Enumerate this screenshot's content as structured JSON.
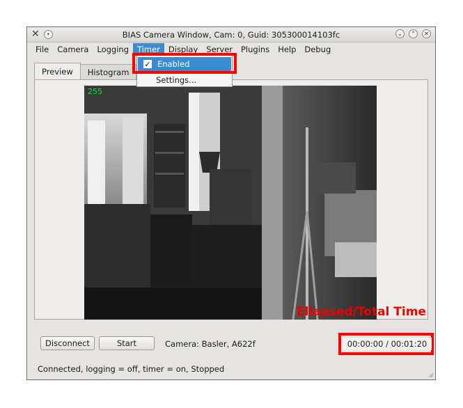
{
  "window": {
    "title": "BIAS Camera Window, Cam: 0, Guid: 305300014103fc"
  },
  "menubar": {
    "items": [
      {
        "label": "File",
        "active": false
      },
      {
        "label": "Camera",
        "active": false
      },
      {
        "label": "Logging",
        "active": false
      },
      {
        "label": "Timer",
        "active": true
      },
      {
        "label": "Display",
        "active": false
      },
      {
        "label": "Server",
        "active": false
      },
      {
        "label": "Plugins",
        "active": false
      },
      {
        "label": "Help",
        "active": false
      },
      {
        "label": "Debug",
        "active": false
      }
    ]
  },
  "timer_menu": {
    "enabled_label": "Enabled",
    "enabled_checked": true,
    "settings_label": "Settings..."
  },
  "tabs": [
    {
      "label": "Preview",
      "active": true
    },
    {
      "label": "Histogram",
      "active": false
    }
  ],
  "preview": {
    "max_level": "255"
  },
  "controls": {
    "disconnect_label": "Disconnect",
    "start_label": "Start",
    "camera_info": "Camera:  Basler,  A622f",
    "time": "00:00:00 / 00:01:20"
  },
  "status": "Connected, logging = off, timer = on, Stopped",
  "annotation": {
    "text": "Ellapsed/Total Time",
    "color": "#ff0000"
  },
  "colors": {
    "highlight": "#3b8bd0",
    "level_text": "#22dd22"
  }
}
